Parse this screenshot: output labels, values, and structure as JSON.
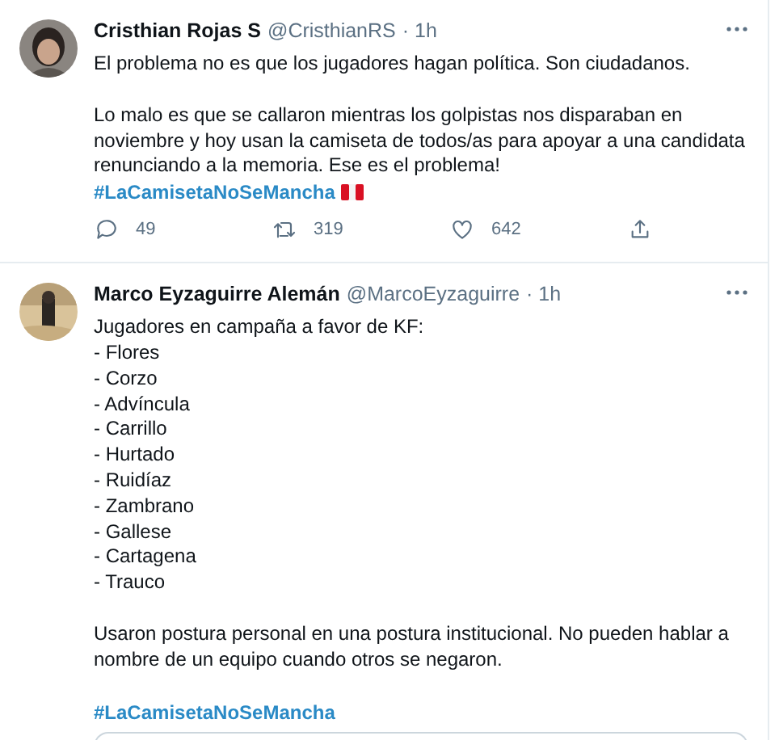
{
  "tweets": [
    {
      "name": "Cristhian Rojas S",
      "handle": "@CristhianRS",
      "time": "· 1h",
      "paragraphs": [
        [
          {
            "kind": "text",
            "text": "El problema no es que los jugadores hagan política. Son ciudadanos."
          }
        ],
        [
          {
            "kind": "text",
            "text": "Lo malo es que se callaron mientras los golpistas nos disparaban en\nnoviembre y hoy usan la camiseta de todos/as para apoyar a una candidata\nrenunciando a la memoria. Ese es el problema!"
          },
          {
            "kind": "hashtag",
            "text": "#LaCamisetaNoSeMancha",
            "flag": true
          }
        ]
      ],
      "actions": [
        {
          "kind": "reply",
          "count": "49"
        },
        {
          "kind": "retweet",
          "count": "319"
        },
        {
          "kind": "like",
          "count": "642"
        },
        {
          "kind": "share"
        }
      ],
      "quoted": false
    },
    {
      "name": "Marco Eyzaguirre Alemán",
      "handle": "@MarcoEyzaguirre",
      "time": "· 1h",
      "paragraphs": [
        [
          {
            "kind": "text",
            "text": "Jugadores en campaña a favor de KF:\n- Flores\n- Corzo\n- Advíncula\n- Carrillo\n- Hurtado\n- Ruidíaz\n- Zambrano\n- Gallese\n- Cartagena\n- Trauco"
          }
        ],
        [
          {
            "kind": "text",
            "text": "Usaron postura personal en una postura institucional. No pueden hablar a\nnombre de un equipo cuando otros se negaron."
          }
        ],
        [
          {
            "kind": "hashtag",
            "text": "#LaCamisetaNoSeMancha",
            "flag": false
          }
        ]
      ],
      "quoted": true
    }
  ]
}
